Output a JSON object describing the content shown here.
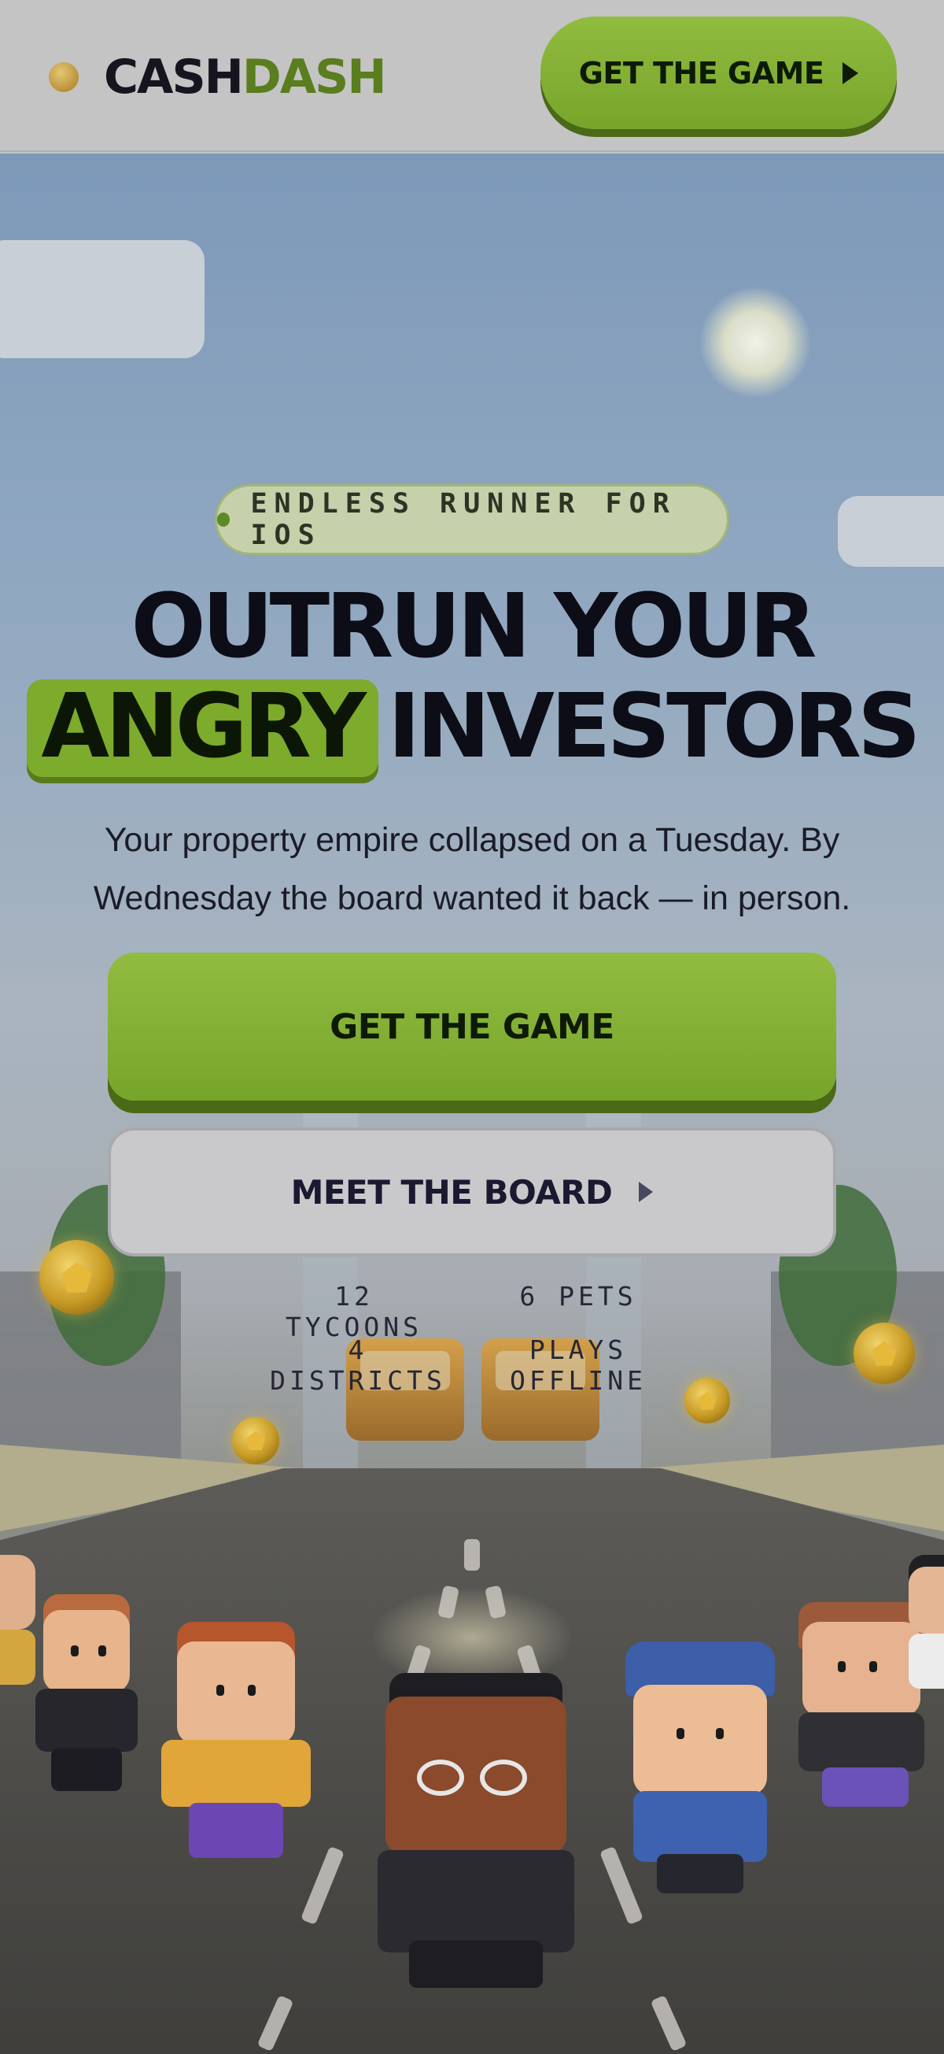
{
  "header": {
    "logo_cash": "CASH",
    "logo_dash": "DASH",
    "cta_label": "GET THE GAME"
  },
  "hero": {
    "badge": "ENDLESS RUNNER FOR IOS",
    "headline_line1": "OUTRUN YOUR",
    "headline_highlight": "ANGRY",
    "headline_line2_rest": "INVESTORS",
    "subtitle": "Your property empire collapsed on a Tuesday. By Wednesday the board wanted it back — in person.",
    "primary_cta": "GET THE GAME",
    "secondary_cta": "MEET THE BOARD",
    "stats": [
      "12 TYCOONS",
      "6 PETS",
      "4 DISTRICTS",
      "PLAYS OFFLINE"
    ]
  },
  "icons": {
    "header_cta_icon": "play-triangle-icon",
    "secondary_cta_icon": "play-triangle-icon",
    "logo_icon": "coin-icon",
    "badge_icon": "dot-icon"
  },
  "colors": {
    "accent_green": "#7dab2b",
    "dark_text": "#0d0d17",
    "header_bg": "#c4c4c4"
  }
}
